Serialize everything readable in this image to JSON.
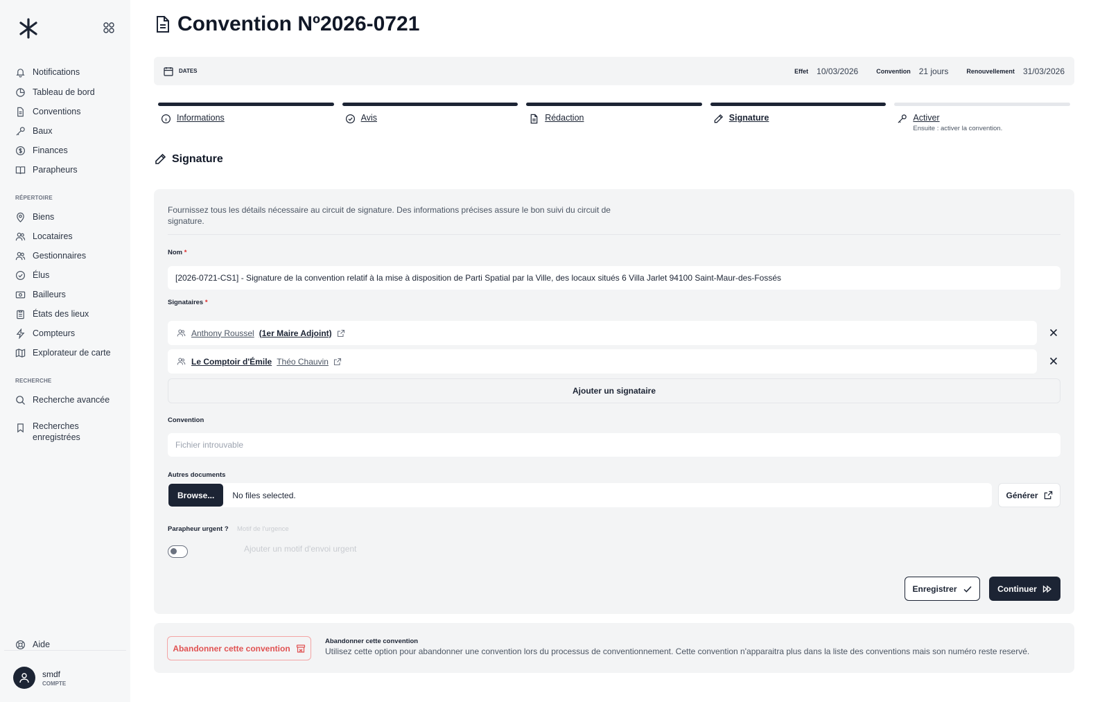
{
  "sidebar": {
    "nav": [
      {
        "label": "Notifications",
        "icon": "bell-icon"
      },
      {
        "label": "Tableau de bord",
        "icon": "dashboard-icon"
      },
      {
        "label": "Conventions",
        "icon": "document-icon"
      },
      {
        "label": "Baux",
        "icon": "key-icon"
      },
      {
        "label": "Finances",
        "icon": "dollar-icon"
      },
      {
        "label": "Parapheurs",
        "icon": "book-icon"
      }
    ],
    "section_repertoire": "RÉPERTOIRE",
    "repertoire": [
      {
        "label": "Biens",
        "icon": "map-pin-icon"
      },
      {
        "label": "Locataires",
        "icon": "users-icon"
      },
      {
        "label": "Gestionnaires",
        "icon": "users-icon"
      },
      {
        "label": "Élus",
        "icon": "check-circle-icon"
      },
      {
        "label": "Bailleurs",
        "icon": "money-icon"
      },
      {
        "label": "États des lieux",
        "icon": "clipboard-icon"
      },
      {
        "label": "Compteurs",
        "icon": "bolt-icon"
      },
      {
        "label": "Explorateur de carte",
        "icon": "map-icon"
      }
    ],
    "section_recherche": "RECHERCHE",
    "recherche": [
      {
        "label": "Recherche avancée",
        "icon": "search-icon"
      },
      {
        "label": "Recherches enregistrées",
        "icon": "bookmark-icon"
      }
    ],
    "help_label": "Aide",
    "user": {
      "name": "smdf",
      "role": "COMPTE"
    }
  },
  "page": {
    "title": "Convention Nº2026-0721"
  },
  "dates": {
    "label": "DATES",
    "effet_label": "Effet",
    "effet_value": "10/03/2026",
    "convention_label": "Convention",
    "convention_value": "21 jours",
    "renouvellement_label": "Renouvellement",
    "renouvellement_value": "31/03/2026"
  },
  "steps": [
    {
      "label": "Informations",
      "icon": "info-icon",
      "status": "done"
    },
    {
      "label": "Avis",
      "icon": "check-circle-icon",
      "status": "done"
    },
    {
      "label": "Rédaction",
      "icon": "document-icon",
      "status": "done"
    },
    {
      "label": "Signature",
      "icon": "pen-icon",
      "status": "active"
    },
    {
      "label": "Activer",
      "icon": "key-icon",
      "status": "pending",
      "sub": "Ensuite : activer la convention."
    }
  ],
  "section": {
    "title": "Signature"
  },
  "form": {
    "description": "Fournissez tous les détails nécessaire au circuit de signature. Des informations précises assure le bon suivi du circuit de signature.",
    "nom_label": "Nom",
    "required_mark": "*",
    "nom_value": "[2026-0721-CS1] - Signature de la convention relatif à la mise à disposition de Parti Spatial par la Ville, des locaux situés 6 Villa Jarlet 94100 Saint-Maur-des-Fossés",
    "signataires_label": "Signataires",
    "signers": [
      {
        "name": "Anthony Roussel",
        "role": "(1er Maire Adjoint)"
      },
      {
        "org": "Le Comptoir d'Émile",
        "name": "Théo Chauvin"
      }
    ],
    "add_signer": "Ajouter un signataire",
    "convention_label": "Convention",
    "convention_placeholder": "Fichier introuvable",
    "autres_docs_label": "Autres documents",
    "browse": "Browse...",
    "no_files": "No files selected.",
    "generate": "Générer",
    "urgent_label": "Parapheur urgent ?",
    "motif_label": "Motif de l'urgence",
    "motif_placeholder": "Ajouter un motif d'envoi urgent",
    "urgent_value": false,
    "save": "Enregistrer",
    "continue": "Continuer"
  },
  "abandon": {
    "button": "Abandonner cette convention",
    "title": "Abandonner cette convention",
    "text": "Utilisez cette option pour abandonner une convention lors du processus de conventionnement. Cette convention n'apparaitra plus dans la liste des conventions mais son numéro reste reservé."
  },
  "colors": {
    "primary": "#1c2434",
    "danger": "#e05252",
    "panel": "#f3f4f5",
    "sidebar": "#f6f7f8"
  }
}
